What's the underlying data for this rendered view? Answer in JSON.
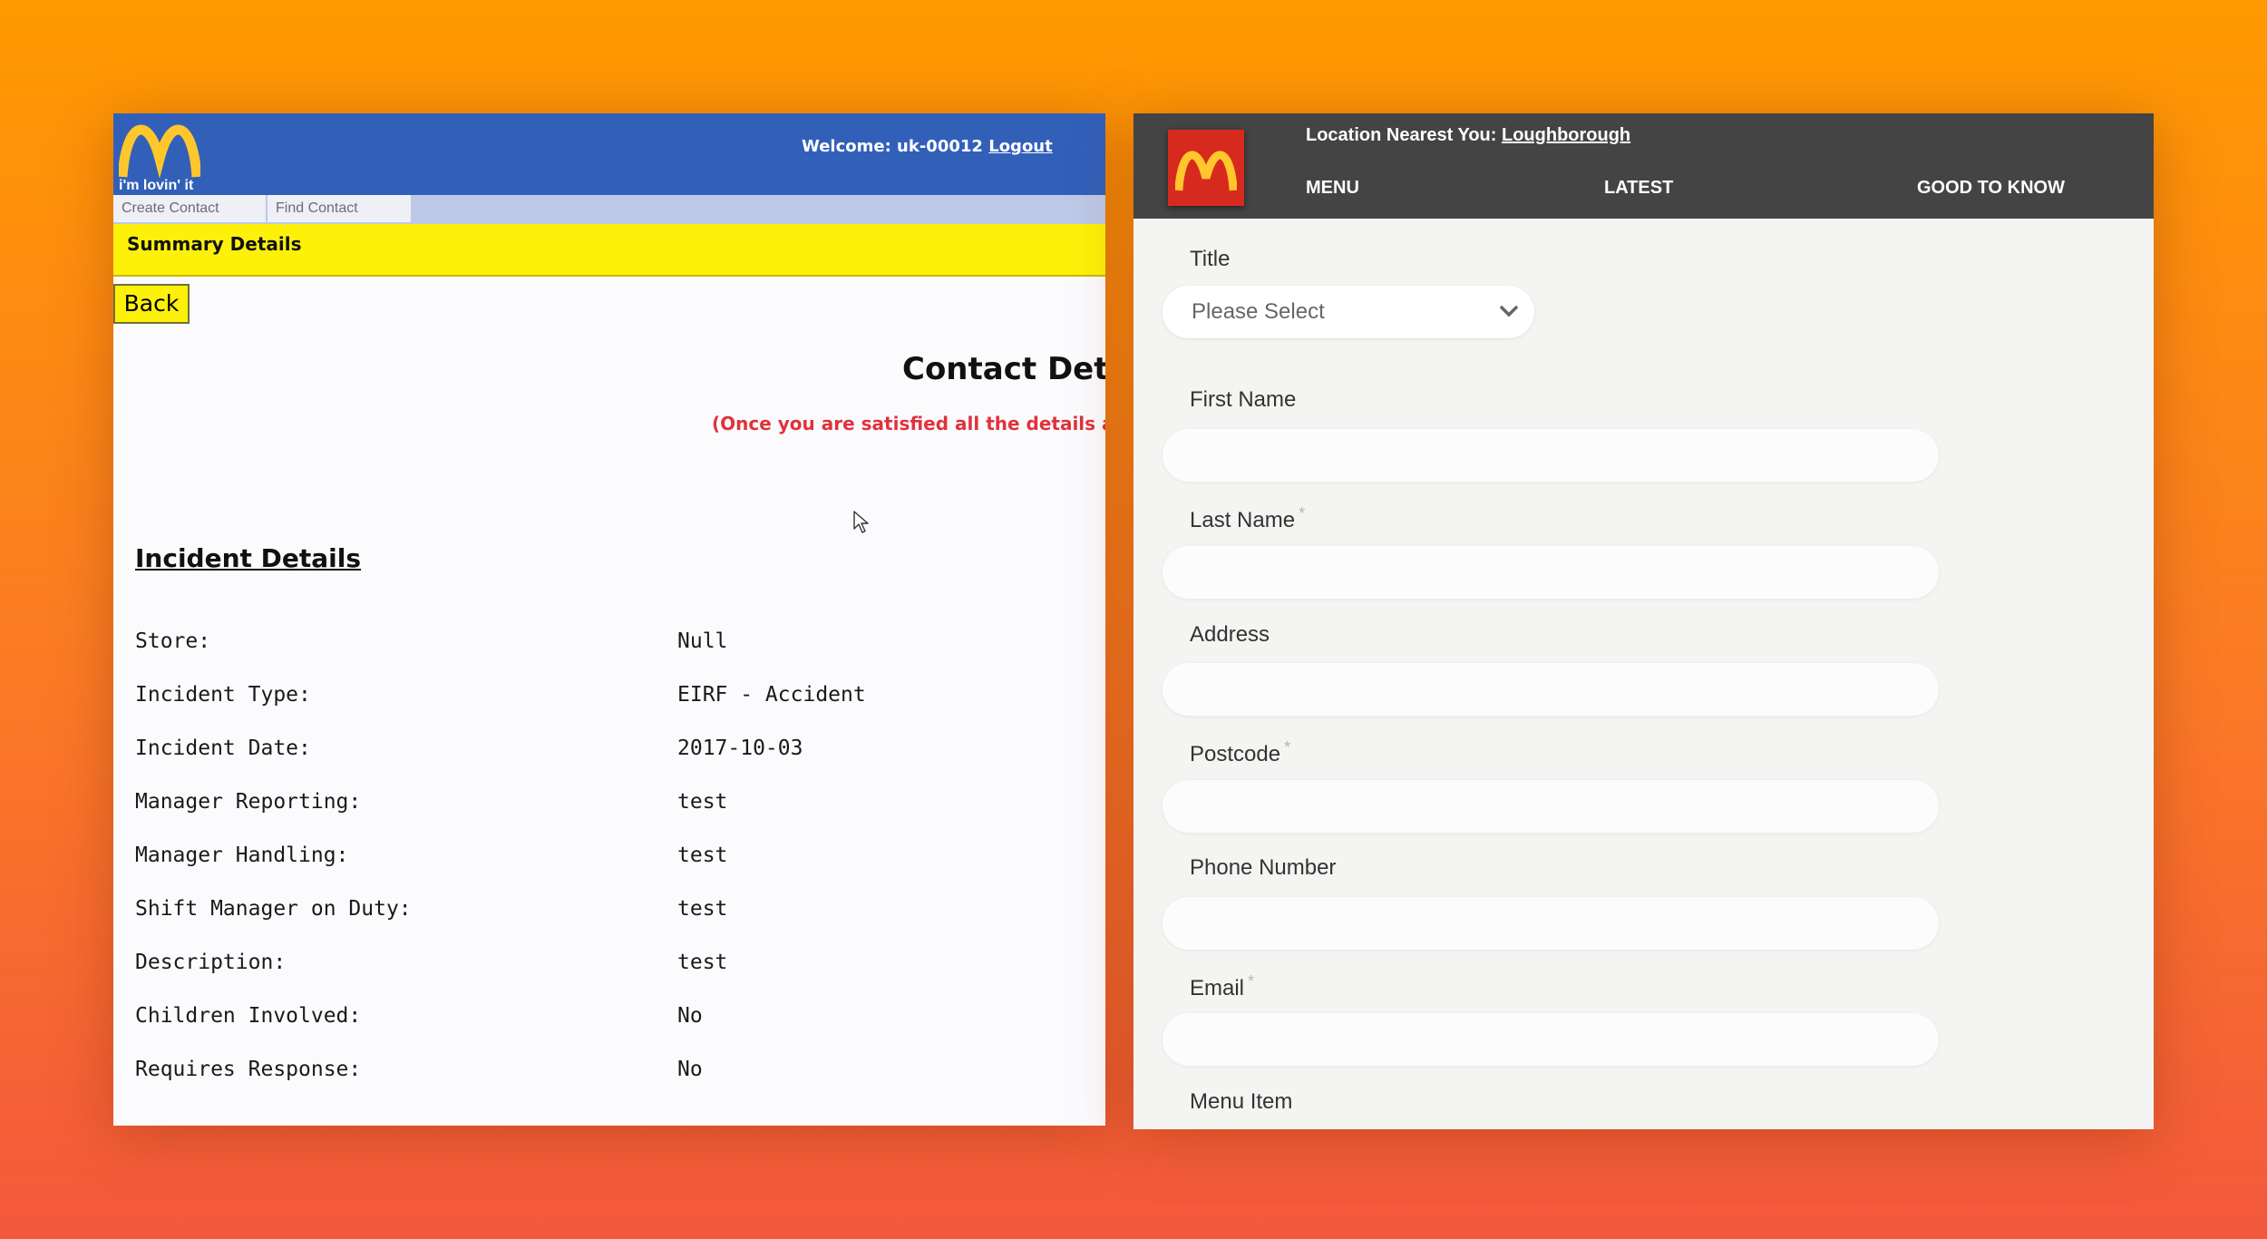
{
  "left_app": {
    "header": {
      "slogan": "i'm lovin' it",
      "welcome_text": "Welcome: uk-00012",
      "logout_label": "Logout"
    },
    "nav_tabs": [
      {
        "label": "Create Contact"
      },
      {
        "label": "Find Contact"
      }
    ],
    "section_bar": "Summary Details",
    "back_label": "Back",
    "contact_title": "Contact Det",
    "notice": "(Once you are satisfied all the details are",
    "incident_title": "Incident Details",
    "details": [
      {
        "label": "Store:",
        "value": "Null"
      },
      {
        "label": "Incident Type:",
        "value": "EIRF - Accident"
      },
      {
        "label": "Incident Date:",
        "value": "2017-10-03"
      },
      {
        "label": "Manager Reporting:",
        "value": "test"
      },
      {
        "label": "Manager Handling:",
        "value": "test"
      },
      {
        "label": "Shift Manager on Duty:",
        "value": "test"
      },
      {
        "label": "Description:",
        "value": "test"
      },
      {
        "label": "Children Involved:",
        "value": "No"
      },
      {
        "label": "Requires Response:",
        "value": "No"
      }
    ],
    "colors": {
      "header": "#3260b9",
      "section_bar": "#fdf10a",
      "notice": "#e0323c"
    }
  },
  "right_app": {
    "location_label": "Location Nearest You:",
    "location_value": "Loughborough",
    "nav": {
      "menu": "MENU",
      "latest": "LATEST",
      "good_to_know": "GOOD TO KNOW"
    },
    "form": {
      "title_label": "Title",
      "title_select_value": "Please Select",
      "first_name_label": "First Name",
      "last_name_label": "Last Name",
      "address_label": "Address",
      "postcode_label": "Postcode",
      "phone_label": "Phone Number",
      "email_label": "Email",
      "menu_item_label": "Menu Item",
      "required_marker": "*"
    },
    "colors": {
      "header": "#444444",
      "logo_bg": "#d72a1f",
      "logo_arches": "#ffc72c"
    }
  }
}
